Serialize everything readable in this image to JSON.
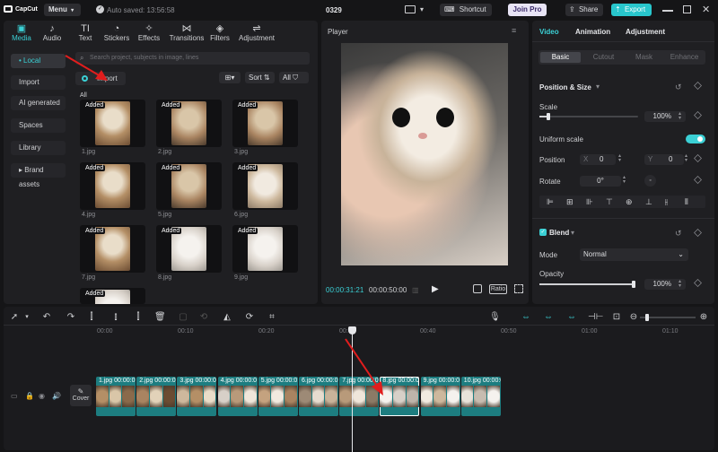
{
  "topbar": {
    "logo": "CapCut",
    "menu_label": "Menu",
    "autosave": "Auto saved: 13:56:58",
    "project_name": "0329",
    "shortcut_label": "Shortcut",
    "join_pro_label": "Join Pro",
    "share_label": "Share",
    "export_label": "Export"
  },
  "media": {
    "tabs": [
      "Media",
      "Audio",
      "Text",
      "Stickers",
      "Effects",
      "Transitions",
      "Filters",
      "Adjustment"
    ],
    "sidebar": [
      "• Local",
      "Import",
      "AI generated",
      "Spaces",
      "Library",
      "▸ Brand assets"
    ],
    "search_placeholder": "Search project, subjects in image, lines",
    "import_label": "Import",
    "sort_label": "Sort",
    "all_label": "All",
    "section_label": "All",
    "added_badge": "Added",
    "files": [
      "1.jpg",
      "2.jpg",
      "3.jpg",
      "4.jpg",
      "5.jpg",
      "6.jpg",
      "7.jpg",
      "8.jpg",
      "9.jpg"
    ]
  },
  "player": {
    "title": "Player",
    "current_time": "00:00:31:21",
    "total_time": "00:00:50:00",
    "ratio_label": "Ratio"
  },
  "inspector": {
    "tabs": [
      "Video",
      "Animation",
      "Adjustment"
    ],
    "subtabs": [
      "Basic",
      "Cutout",
      "Mask",
      "Enhance"
    ],
    "position_size_title": "Position & Size",
    "scale_label": "Scale",
    "scale_value": "100%",
    "uniform_scale_label": "Uniform scale",
    "position_label": "Position",
    "x_label": "X",
    "x_value": "0",
    "y_label": "Y",
    "y_value": "0",
    "rotate_label": "Rotate",
    "rotate_value": "0°",
    "blend_title": "Blend",
    "mode_label": "Mode",
    "mode_value": "Normal",
    "opacity_label": "Opacity",
    "opacity_value": "100%",
    "scale_level": 0.1,
    "opacity_level": 1.0
  },
  "timeline": {
    "ruler": [
      "00:00",
      "00:10",
      "00:20",
      "00:30",
      "00:40",
      "00:50",
      "01:00",
      "01:10"
    ],
    "cover_label": "Cover",
    "clips": [
      {
        "label": "1.jpg  00:00:0"
      },
      {
        "label": "2.jpg  00:00:0"
      },
      {
        "label": "3.jpg  00:00:0"
      },
      {
        "label": "4.jpg  00:00:0"
      },
      {
        "label": "5.jpg  00:00:0"
      },
      {
        "label": "6.jpg  00:00:0"
      },
      {
        "label": "7.jpg  00:00:0"
      },
      {
        "label": "8.jpg  00:00:0"
      },
      {
        "label": "9.jpg  00:00:0"
      },
      {
        "label": "10.jpg  00:00:0"
      }
    ]
  },
  "colors": {
    "accent": "#3bd0d5",
    "export_bg": "#28c6cc",
    "annotation_arrow": "#e11d1d"
  }
}
